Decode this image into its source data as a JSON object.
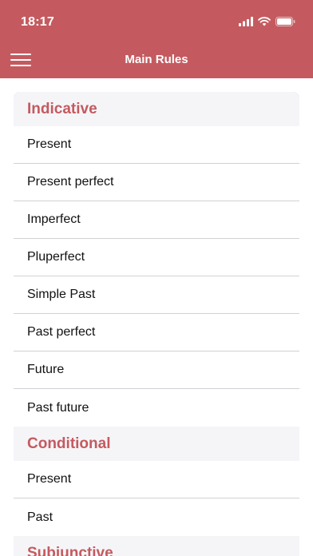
{
  "status_bar": {
    "time": "18:17"
  },
  "nav": {
    "title": "Main Rules"
  },
  "sections": [
    {
      "title": "Indicative",
      "items": [
        "Present",
        "Present perfect",
        "Imperfect",
        "Pluperfect",
        "Simple Past",
        "Past perfect",
        "Future",
        "Past future"
      ]
    },
    {
      "title": "Conditional",
      "items": [
        "Present",
        "Past"
      ]
    },
    {
      "title": "Subjunctive",
      "items": []
    }
  ],
  "colors": {
    "accent": "#c45a5f",
    "section_background": "#f5f5f8",
    "divider": "#d2d2d6"
  },
  "icons": {
    "menu": "hamburger-menu-icon",
    "signal": "cellular-signal-icon",
    "wifi": "wifi-icon",
    "battery": "battery-icon"
  }
}
